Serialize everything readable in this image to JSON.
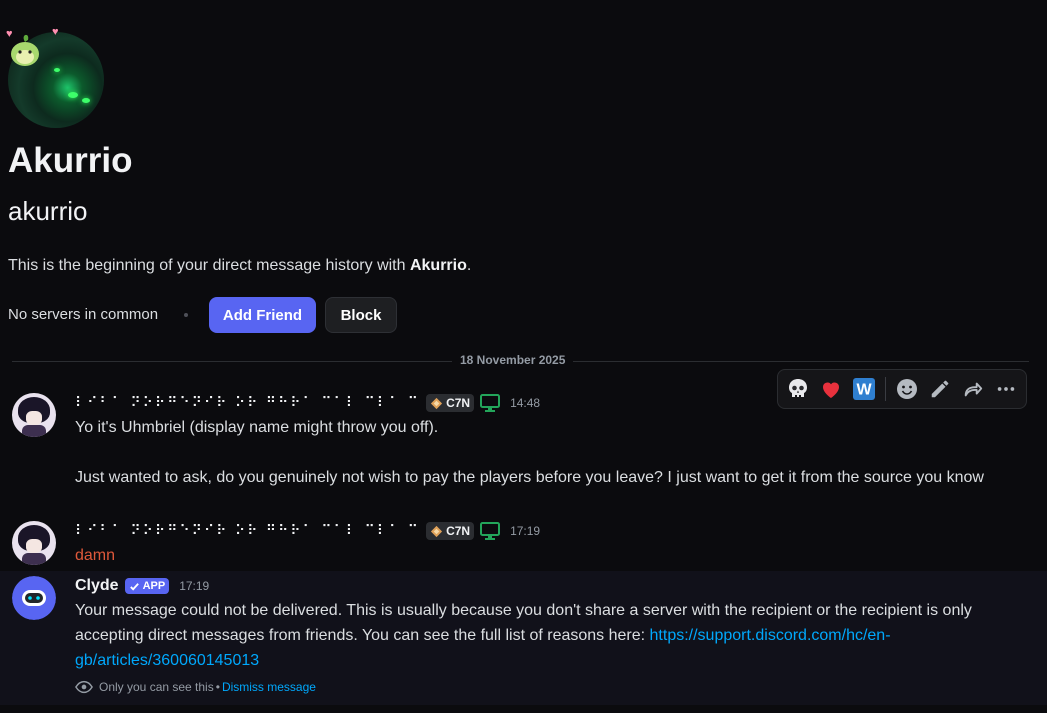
{
  "profile": {
    "display_name": "Akurrio",
    "username": "akurrio",
    "intro_prefix": "This is the beginning of your direct message history with ",
    "intro_name": "Akurrio",
    "intro_suffix": ".",
    "mutual_servers": "No servers in common",
    "add_friend_label": "Add Friend",
    "block_label": "Block"
  },
  "divider": {
    "date": "18 November 2025"
  },
  "toolbar": {
    "icons": [
      "skull-emoji-icon",
      "heart-emoji-icon",
      "w-emoji-icon",
      "add-reaction-icon",
      "edit-icon",
      "forward-icon",
      "more-icon"
    ]
  },
  "messages": [
    {
      "author": "⠇⠊⠃⠁ ⠝⠕⠗⠛⠑⠝⠊⠗ ⠕⠗ ⠛⠓⠗⠁ ⠉⠁⠇ ⠉⠇⠁ ⠉",
      "guild_tag": "C7N",
      "time": "14:48",
      "lines": [
        "Yo it's Uhmbriel (display name might throw you off).",
        "Just wanted to ask, do you genuinely not wish to pay the players before you leave? I just want to get it from the source you know"
      ]
    },
    {
      "author": "⠇⠊⠃⠁ ⠝⠕⠗⠛⠑⠝⠊⠗ ⠕⠗ ⠛⠓⠗⠁ ⠉⠁⠇ ⠉⠇⠁ ⠉",
      "guild_tag": "C7N",
      "time": "17:19",
      "text": "damn"
    }
  ],
  "clyde": {
    "name": "Clyde",
    "badge": "APP",
    "time": "17:19",
    "text": "Your message could not be delivered. This is usually because you don't share a server with the recipient or the recipient is only accepting direct messages from friends. You can see the full list of reasons here: ",
    "link": "https://support.discord.com/hc/en-gb/articles/360060145013",
    "note": "Only you can see this",
    "note_sep": "•",
    "dismiss": "Dismiss message"
  },
  "colors": {
    "accent": "#5865f2",
    "link": "#00a8fc",
    "red_text": "#e0593b"
  }
}
